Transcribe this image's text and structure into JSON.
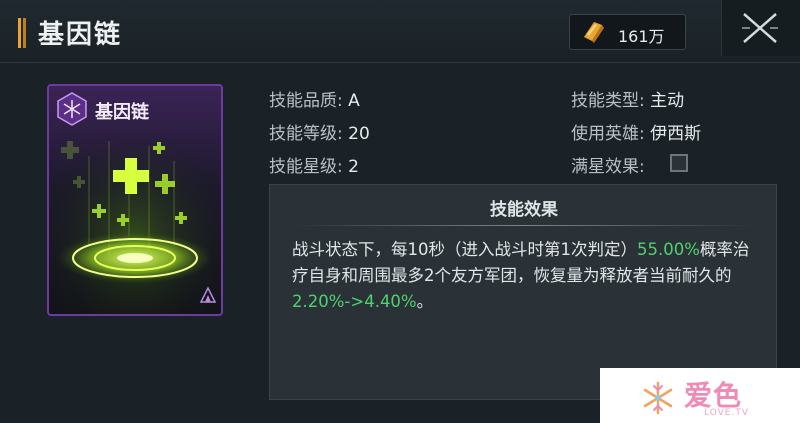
{
  "header": {
    "title": "基因链",
    "currency_amount": "161万",
    "currency_icon": "gold-ingot-icon",
    "close_icon": "close-x-icon"
  },
  "skill_card": {
    "title": "基因链",
    "badge_icon": "gene-hexagon-icon",
    "art": "green-heal-crosses-art",
    "corner_icon": "purple-rarity-icon",
    "colors": {
      "border": "#6d3aa0",
      "glow": "#c8ff3a"
    }
  },
  "stats": {
    "quality_label": "技能品质:",
    "quality_value": "A",
    "level_label": "技能等级:",
    "level_value": "20",
    "star_label": "技能星级:",
    "star_value": "2",
    "type_label": "技能类型:",
    "type_value": "主动",
    "hero_label": "使用英雄:",
    "hero_value": "伊西斯",
    "maxstar_label": "满星效果:",
    "maxstar_checked": false
  },
  "effect": {
    "title": "技能效果",
    "text_1": "战斗状态下，每10秒（进入战斗时第1次判定）",
    "highlight_1": "55.00%",
    "text_2": "概率治疗自身和周围最多2个友方军团，恢复量为释放者当前耐久的",
    "highlight_2": "2.20%->4.40%",
    "text_3": "。",
    "highlight_color": "#4fd16e"
  },
  "watermark": {
    "text": "爱色",
    "sub": "LOVE.TV"
  }
}
